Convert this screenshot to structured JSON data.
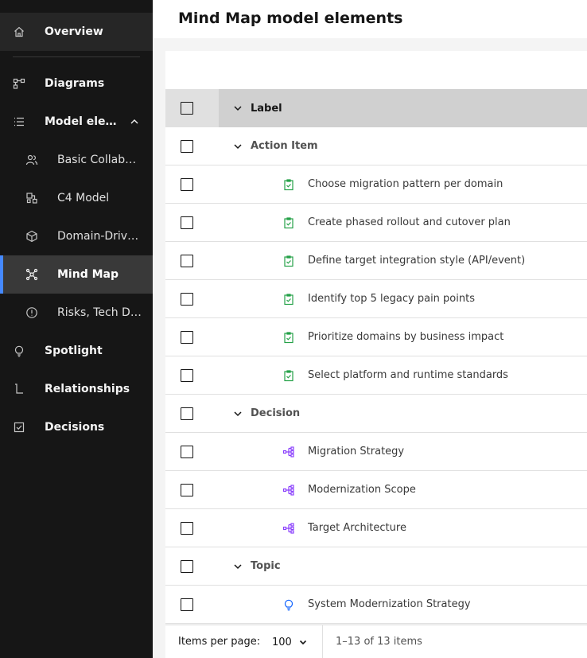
{
  "sidebar": {
    "items": [
      {
        "label": "Overview",
        "icon": "home-icon"
      },
      {
        "label": "Diagrams",
        "icon": "diagram-icon"
      },
      {
        "label": "Model elements",
        "icon": "list-icon"
      },
      {
        "label": "Basic Collaboration",
        "icon": "group-icon"
      },
      {
        "label": "C4 Model",
        "icon": "c4-blocks-icon"
      },
      {
        "label": "Domain-Driven Design",
        "icon": "cube-icon"
      },
      {
        "label": "Mind Map",
        "icon": "mind-map-icon"
      },
      {
        "label": "Risks, Tech Debt",
        "icon": "warning-circle-icon"
      },
      {
        "label": "Spotlight",
        "icon": "lightbulb-icon"
      },
      {
        "label": "Relationships",
        "icon": "relationship-icon"
      },
      {
        "label": "Decisions",
        "icon": "checkbox-checked-icon"
      }
    ]
  },
  "header": {
    "title": "Mind Map model elements"
  },
  "table": {
    "column_label": "Label",
    "groups": [
      {
        "name": "Action Item",
        "icon": "task-icon",
        "rows": [
          "Choose migration pattern per domain",
          "Create phased rollout and cutover plan",
          "Define target integration style (API/event)",
          "Identify top 5 legacy pain points",
          "Prioritize domains by business impact",
          "Select platform and runtime standards"
        ]
      },
      {
        "name": "Decision",
        "icon": "decision-tree-icon",
        "rows": [
          "Migration Strategy",
          "Modernization Scope",
          "Target Architecture"
        ]
      },
      {
        "name": "Topic",
        "icon": "lightbulb-icon",
        "rows": [
          "System Modernization Strategy"
        ]
      }
    ]
  },
  "pagination": {
    "items_per_page_label": "Items per page:",
    "items_per_page_value": "100",
    "range_text": "1–13 of 13 items"
  },
  "colors": {
    "sidebar_bg": "#161616",
    "active_indicator": "#4589ff",
    "action_item_icon": "#24a148",
    "decision_icon": "#8a3ffc",
    "topic_icon": "#0f62fe"
  }
}
